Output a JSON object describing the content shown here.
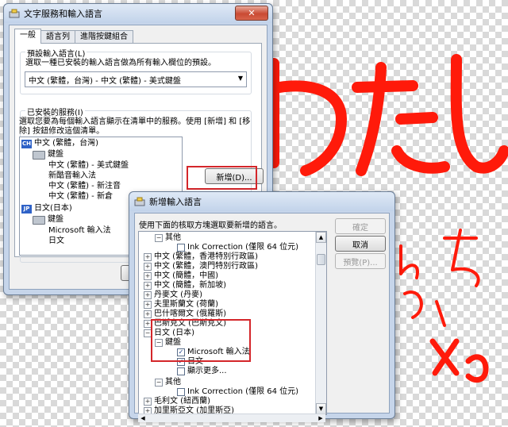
{
  "background": {
    "handwriting_color": "#ff1a0a",
    "handwriting_text": "わたし"
  },
  "main_dialog": {
    "title": "文字服務和輸入語言",
    "close": "✕",
    "tabs": [
      "一般",
      "語言列",
      "進階按鍵組合"
    ],
    "default_group": {
      "label": "預設輸入語言(L)",
      "description": "選取一種已安裝的輸入語言做為所有輸入欄位的預設。",
      "selected": "中文 (繁體，台灣) - 中文 (繁體) - 美式鍵盤"
    },
    "installed_group": {
      "label": "已安裝的服務(I)",
      "description_line1": "選取您要為每個輸入語言顯示在清單中的服務。使用 [新增] 和 [移",
      "description_line2": "除] 按鈕修改這個清單。",
      "tree": [
        {
          "badge": "CH",
          "text": "中文 (繁體，台灣)"
        },
        {
          "icon": "keyboard-icon",
          "text": "鍵盤"
        },
        {
          "text": "中文 (繁體) - 美式鍵盤"
        },
        {
          "text": "新酷音輸入法"
        },
        {
          "text": "中文 (繁體) - 新注音"
        },
        {
          "text": "中文 (繁體) - 新倉"
        },
        {
          "badge": "JP",
          "text": "日文(日本)"
        },
        {
          "icon": "keyboard-icon",
          "text": "鍵盤"
        },
        {
          "text": "Microsoft 輸入法"
        },
        {
          "text": "日文"
        }
      ],
      "add_button": "新增(D)..."
    }
  },
  "add_dialog": {
    "title": "新增輸入語言",
    "instruction": "使用下面的核取方塊選取要新增的語言。",
    "buttons": {
      "ok": "確定",
      "cancel": "取消",
      "preview": "預覽(P)..."
    },
    "tree": [
      {
        "exp": "−",
        "text": "其他"
      },
      {
        "check": "",
        "text": "Ink Correction (僅限 64 位元)"
      },
      {
        "exp": "+",
        "text": "中文 (繁體，香港特別行政區)"
      },
      {
        "exp": "+",
        "text": "中文 (繁體，澳門特別行政區)"
      },
      {
        "exp": "+",
        "text": "中文 (簡體，中國)"
      },
      {
        "exp": "+",
        "text": "中文 (簡體，新加坡)"
      },
      {
        "exp": "+",
        "text": "丹麥文 (丹麥)"
      },
      {
        "exp": "+",
        "text": "夫里斯蘭文 (荷蘭)"
      },
      {
        "exp": "+",
        "text": "巴什喀爾文 (俄羅斯)"
      },
      {
        "exp": "+",
        "text": "巴斯克文 (巴斯克文)"
      },
      {
        "exp": "−",
        "text": "日文 (日本)"
      },
      {
        "exp": "−",
        "text": "鍵盤"
      },
      {
        "check": "✓",
        "text": "Microsoft 輸入法"
      },
      {
        "check": "✓",
        "text": "日文"
      },
      {
        "check": "",
        "text": "顯示更多..."
      },
      {
        "exp": "−",
        "text": "其他"
      },
      {
        "check": "",
        "text": "Ink Correction (僅限 64 位元)"
      },
      {
        "exp": "+",
        "text": "毛利文 (紐西蘭)"
      },
      {
        "exp": "+",
        "text": "加里斯亞文 (加里斯亞)"
      }
    ]
  }
}
